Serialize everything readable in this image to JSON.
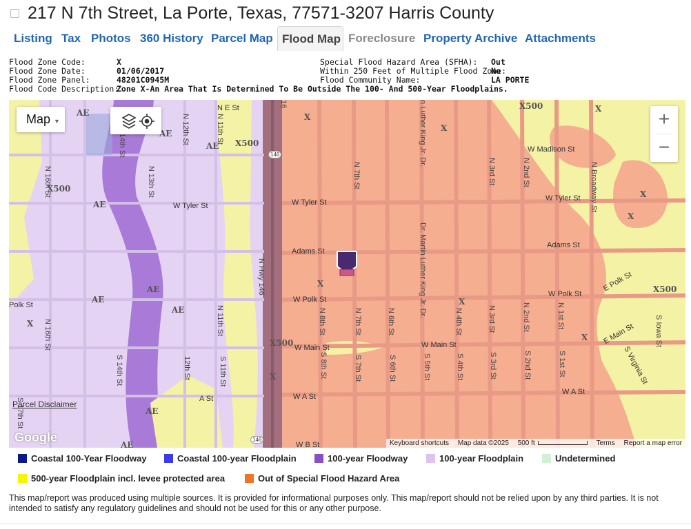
{
  "header": {
    "title": "217 N 7th Street, La Porte, Texas, 77571-3207 Harris County"
  },
  "tabs": [
    {
      "label": "Listing"
    },
    {
      "label": "Tax"
    },
    {
      "label": "Photos"
    },
    {
      "label": "360 History"
    },
    {
      "label": "Parcel Map"
    },
    {
      "label": "Flood Map"
    },
    {
      "label": "Foreclosure"
    },
    {
      "label": "Property Archive"
    },
    {
      "label": "Attachments"
    }
  ],
  "flood_info": {
    "left": [
      {
        "label": "Flood Zone Code:",
        "value": "X"
      },
      {
        "label": "Flood Zone Date:",
        "value": "01/06/2017"
      },
      {
        "label": "Flood Zone Panel:",
        "value": "48201C0945M"
      },
      {
        "label": "Flood Code Description:",
        "value": "Zone X-An Area That Is Determined To Be Outside The 100- And 500-Year Floodplains."
      }
    ],
    "right": [
      {
        "label": "Special Flood Hazard Area (SFHA):",
        "value": "Out"
      },
      {
        "label": "Within 250 Feet of Multiple Flood Zone:",
        "value": "No"
      },
      {
        "label": "Flood Community Name:",
        "value": "LA PORTE"
      }
    ]
  },
  "map": {
    "type_label": "Map",
    "zoom_in": "+",
    "zoom_out": "−",
    "disclaimer": "Parcel Disclaimer",
    "google": "Google",
    "attribution": {
      "shortcuts": "Keyboard shortcuts",
      "data": "Map data ©2025",
      "scale": "500 ft",
      "terms": "Terms",
      "report": "Report a map error"
    },
    "streets": {
      "ne": "N E St",
      "w_tyler": "W Tyler St",
      "w_tyler_r": "W Tyler St",
      "w_madison": "W Madison St",
      "adams": "Adams St",
      "adams_r": "Adams St",
      "w_polk": "W Polk St",
      "w_polk_r": "W Polk St",
      "e_polk": "E Polk St",
      "polk_l": "Polk St",
      "w_main": "W Main St",
      "w_main_r": "W Main St",
      "e_main": "E Main St",
      "w_a": "W A St",
      "w_a_r": "W A St",
      "a_st": "A St",
      "w_b": "W B St",
      "n7": "N 7th St",
      "n8": "N 8th St",
      "n6": "N 6th St",
      "n4": "N 4th St",
      "n3": "N 3rd St",
      "n2": "N 2nd St",
      "n1": "N 1st St",
      "s7": "S 7th St",
      "s8": "S 8th St",
      "s6": "S 6th St",
      "s5": "S 5th St",
      "s4": "S 4th St",
      "s3": "S 3rd St",
      "s2": "S 2nd St",
      "s1": "S 1st St",
      "s14": "S 14th St",
      "n13": "N 13th St",
      "n12": "N 12th St",
      "n11": "N 11th St",
      "s11": "S 11th St",
      "s12": "12th St",
      "n16": "N 16th St",
      "n_hwy": "N Hwy 146",
      "n_broadway": "N Broadway St",
      "s_virginia": "S Virginia St",
      "s_iowa": "S Iowa St",
      "mlk": "Dr. Martin Luther King Jr. Dr.",
      "mlk_top": "n Luther King Jr. Dr.",
      "mlk_s": "Dr. Martin Luther King Jr. Dr.",
      "s17": "S 17th St",
      "n_top": "16"
    },
    "zones": {
      "x": "X",
      "ae": "AE",
      "x500": "X500"
    },
    "shields": {
      "h146_top": "146",
      "h146_bot": "146"
    }
  },
  "legend": [
    {
      "label": "Coastal 100-Year Floodway",
      "color": "#0a1a8a"
    },
    {
      "label": "Coastal 100-year Floodplain",
      "color": "#3b3bea"
    },
    {
      "label": "100-year Floodway",
      "color": "#8a4fc4"
    },
    {
      "label": "100-year Floodplain",
      "color": "#dcc3f2"
    },
    {
      "label": "Undetermined",
      "color": "#d4f0d2"
    },
    {
      "label": "500-year Floodplain incl. levee protected area",
      "color": "#f7f500"
    },
    {
      "label": "Out of Special Flood Hazard Area",
      "color": "#f07426"
    }
  ],
  "footnote": "This map/report was produced using multiple sources. It is provided for informational purposes only. This map/report should not be relied upon by any third parties. It is not intended to satisfy any regulatory guidelines and should not be used for this or any other purpose."
}
